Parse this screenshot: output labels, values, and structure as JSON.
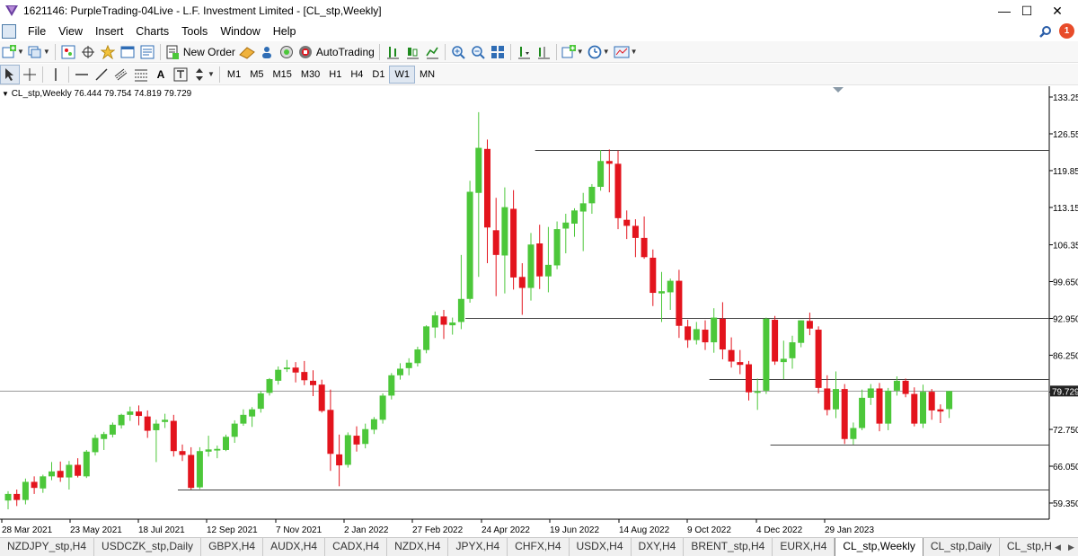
{
  "window": {
    "title": "1621146: PurpleTrading-04Live - L.F. Investment Limited - [CL_stp,Weekly]",
    "minimize": "—",
    "maximize": "☐",
    "close": "✕"
  },
  "menu": {
    "items": [
      "File",
      "View",
      "Insert",
      "Charts",
      "Tools",
      "Window",
      "Help"
    ],
    "notification_count": "1"
  },
  "toolbar1": {
    "new_order_label": "New Order",
    "autotrading_label": "AutoTrading"
  },
  "toolbar2": {
    "text_tool": "A",
    "timeframes": [
      "M1",
      "M5",
      "M15",
      "M30",
      "H1",
      "H4",
      "D1",
      "W1",
      "MN"
    ],
    "active_timeframe": "W1"
  },
  "chart": {
    "info_label": "CL_stp,Weekly  76.444 79.754 74.819 79.729",
    "current_price": "79.729",
    "colors": {
      "bull": "#4cc73a",
      "bear": "#e3141d",
      "grid_line": "#808080",
      "price_tag": "#222222"
    }
  },
  "chart_data": {
    "type": "candlestick",
    "symbol": "CL_stp",
    "timeframe": "Weekly",
    "ohlc_readout": {
      "open": 76.444,
      "high": 79.754,
      "low": 74.819,
      "close": 79.729
    },
    "y_ticks": [
      "133.25",
      "126.55",
      "119.85",
      "113.15",
      "106.35",
      "99.650",
      "92.950",
      "86.250",
      "79.550",
      "72.750",
      "66.050",
      "59.350"
    ],
    "y_tick_values": [
      133.25,
      126.55,
      119.85,
      113.15,
      106.35,
      99.65,
      92.95,
      86.25,
      79.55,
      72.75,
      66.05,
      59.35
    ],
    "x_ticks": [
      "28 Mar 2021",
      "23 May 2021",
      "18 Jul 2021",
      "12 Sep 2021",
      "7 Nov 2021",
      "2 Jan 2022",
      "27 Feb 2022",
      "24 Apr 2022",
      "19 Jun 2022",
      "14 Aug 2022",
      "9 Oct 2022",
      "4 Dec 2022",
      "29 Jan 2023"
    ],
    "ylim": [
      57.5,
      135.5
    ],
    "horizontal_lines": [
      {
        "price": 123.6,
        "from_week": 61
      },
      {
        "price": 92.95,
        "from_week": 53
      },
      {
        "price": 81.9,
        "from_week": 81
      },
      {
        "price": 79.729,
        "from_week": 0
      },
      {
        "price": 70.0,
        "from_week": 88
      },
      {
        "price": 61.8,
        "from_week": 20
      }
    ],
    "candles": [
      {
        "o": 59.8,
        "h": 61.5,
        "l": 58.2,
        "c": 61.0
      },
      {
        "o": 61.0,
        "h": 61.8,
        "l": 58.8,
        "c": 59.9
      },
      {
        "o": 59.9,
        "h": 63.8,
        "l": 59.1,
        "c": 63.2
      },
      {
        "o": 63.2,
        "h": 64.2,
        "l": 61.0,
        "c": 62.1
      },
      {
        "o": 62.0,
        "h": 64.5,
        "l": 61.2,
        "c": 64.2
      },
      {
        "o": 64.2,
        "h": 66.8,
        "l": 63.5,
        "c": 65.1
      },
      {
        "o": 65.2,
        "h": 66.9,
        "l": 63.2,
        "c": 64.0
      },
      {
        "o": 64.0,
        "h": 67.0,
        "l": 61.8,
        "c": 66.3
      },
      {
        "o": 66.3,
        "h": 67.5,
        "l": 64.0,
        "c": 64.3
      },
      {
        "o": 64.2,
        "h": 69.0,
        "l": 63.9,
        "c": 68.7
      },
      {
        "o": 68.6,
        "h": 71.8,
        "l": 68.0,
        "c": 71.2
      },
      {
        "o": 71.0,
        "h": 72.3,
        "l": 69.0,
        "c": 71.9
      },
      {
        "o": 71.8,
        "h": 74.0,
        "l": 71.3,
        "c": 73.6
      },
      {
        "o": 73.5,
        "h": 75.6,
        "l": 72.9,
        "c": 75.4
      },
      {
        "o": 75.4,
        "h": 76.9,
        "l": 74.3,
        "c": 76.0
      },
      {
        "o": 76.0,
        "h": 77.1,
        "l": 73.5,
        "c": 75.2
      },
      {
        "o": 75.1,
        "h": 76.2,
        "l": 71.2,
        "c": 72.5
      },
      {
        "o": 72.6,
        "h": 74.5,
        "l": 66.8,
        "c": 73.8
      },
      {
        "o": 74.1,
        "h": 75.6,
        "l": 73.0,
        "c": 74.5
      },
      {
        "o": 74.3,
        "h": 75.4,
        "l": 67.8,
        "c": 68.8
      },
      {
        "o": 68.8,
        "h": 70.0,
        "l": 67.0,
        "c": 68.1
      },
      {
        "o": 68.1,
        "h": 69.5,
        "l": 61.8,
        "c": 62.1
      },
      {
        "o": 62.2,
        "h": 69.5,
        "l": 61.9,
        "c": 68.8
      },
      {
        "o": 68.7,
        "h": 71.6,
        "l": 67.8,
        "c": 69.1
      },
      {
        "o": 68.9,
        "h": 69.8,
        "l": 67.5,
        "c": 69.2
      },
      {
        "o": 69.0,
        "h": 71.8,
        "l": 68.8,
        "c": 71.4
      },
      {
        "o": 71.4,
        "h": 74.4,
        "l": 70.3,
        "c": 73.8
      },
      {
        "o": 73.8,
        "h": 76.4,
        "l": 73.4,
        "c": 75.4
      },
      {
        "o": 75.1,
        "h": 76.8,
        "l": 73.2,
        "c": 76.4
      },
      {
        "o": 76.5,
        "h": 79.7,
        "l": 75.8,
        "c": 79.3
      },
      {
        "o": 79.4,
        "h": 82.1,
        "l": 78.9,
        "c": 81.9
      },
      {
        "o": 81.6,
        "h": 84.2,
        "l": 80.9,
        "c": 83.6
      },
      {
        "o": 83.7,
        "h": 85.4,
        "l": 83.2,
        "c": 84.0
      },
      {
        "o": 84.0,
        "h": 85.0,
        "l": 81.3,
        "c": 83.1
      },
      {
        "o": 83.2,
        "h": 85.2,
        "l": 80.8,
        "c": 81.7
      },
      {
        "o": 81.6,
        "h": 83.5,
        "l": 78.8,
        "c": 80.8
      },
      {
        "o": 80.9,
        "h": 81.8,
        "l": 75.8,
        "c": 76.1
      },
      {
        "o": 76.3,
        "h": 80.0,
        "l": 65.2,
        "c": 68.3
      },
      {
        "o": 68.2,
        "h": 71.8,
        "l": 62.4,
        "c": 66.2
      },
      {
        "o": 66.3,
        "h": 72.2,
        "l": 65.8,
        "c": 71.7
      },
      {
        "o": 71.6,
        "h": 73.3,
        "l": 68.7,
        "c": 70.0
      },
      {
        "o": 70.1,
        "h": 73.8,
        "l": 69.3,
        "c": 72.8
      },
      {
        "o": 72.7,
        "h": 75.0,
        "l": 71.9,
        "c": 74.6
      },
      {
        "o": 74.5,
        "h": 79.3,
        "l": 73.8,
        "c": 78.9
      },
      {
        "o": 78.9,
        "h": 83.0,
        "l": 78.2,
        "c": 82.6
      },
      {
        "o": 82.6,
        "h": 84.8,
        "l": 81.8,
        "c": 83.8
      },
      {
        "o": 83.9,
        "h": 85.7,
        "l": 82.6,
        "c": 84.9
      },
      {
        "o": 84.8,
        "h": 87.8,
        "l": 84.2,
        "c": 87.3
      },
      {
        "o": 87.2,
        "h": 91.7,
        "l": 86.6,
        "c": 91.5
      },
      {
        "o": 91.3,
        "h": 94.2,
        "l": 89.4,
        "c": 93.5
      },
      {
        "o": 93.3,
        "h": 94.5,
        "l": 89.2,
        "c": 91.8
      },
      {
        "o": 91.7,
        "h": 93.1,
        "l": 90.0,
        "c": 92.2
      },
      {
        "o": 92.3,
        "h": 104.5,
        "l": 91.0,
        "c": 96.5
      },
      {
        "o": 96.5,
        "h": 118.0,
        "l": 95.8,
        "c": 116.0
      },
      {
        "o": 115.8,
        "h": 130.5,
        "l": 100.5,
        "c": 124.0
      },
      {
        "o": 123.8,
        "h": 125.5,
        "l": 103.0,
        "c": 109.5
      },
      {
        "o": 109.0,
        "h": 114.9,
        "l": 97.0,
        "c": 104.5
      },
      {
        "o": 104.4,
        "h": 116.8,
        "l": 97.5,
        "c": 113.2
      },
      {
        "o": 112.9,
        "h": 116.3,
        "l": 98.2,
        "c": 100.4
      },
      {
        "o": 100.5,
        "h": 103.0,
        "l": 93.6,
        "c": 98.5
      },
      {
        "o": 98.5,
        "h": 108.5,
        "l": 96.2,
        "c": 106.4
      },
      {
        "o": 106.6,
        "h": 110.0,
        "l": 98.3,
        "c": 100.6
      },
      {
        "o": 100.6,
        "h": 109.6,
        "l": 97.7,
        "c": 102.7
      },
      {
        "o": 102.6,
        "h": 110.6,
        "l": 101.9,
        "c": 109.2
      },
      {
        "o": 109.3,
        "h": 112.0,
        "l": 104.8,
        "c": 110.4
      },
      {
        "o": 110.2,
        "h": 113.0,
        "l": 107.8,
        "c": 112.6
      },
      {
        "o": 112.4,
        "h": 115.8,
        "l": 105.2,
        "c": 113.9
      },
      {
        "o": 113.9,
        "h": 117.4,
        "l": 112.0,
        "c": 116.9
      },
      {
        "o": 116.9,
        "h": 123.6,
        "l": 116.2,
        "c": 121.6
      },
      {
        "o": 121.6,
        "h": 123.7,
        "l": 115.9,
        "c": 121.1
      },
      {
        "o": 121.1,
        "h": 123.5,
        "l": 109.2,
        "c": 111.2
      },
      {
        "o": 110.9,
        "h": 112.6,
        "l": 107.4,
        "c": 109.8
      },
      {
        "o": 109.8,
        "h": 111.0,
        "l": 104.1,
        "c": 107.6
      },
      {
        "o": 107.6,
        "h": 111.5,
        "l": 103.8,
        "c": 104.1
      },
      {
        "o": 104.0,
        "h": 105.5,
        "l": 95.2,
        "c": 97.6
      },
      {
        "o": 97.5,
        "h": 101.4,
        "l": 92.3,
        "c": 97.9
      },
      {
        "o": 97.7,
        "h": 100.2,
        "l": 94.5,
        "c": 99.8
      },
      {
        "o": 99.8,
        "h": 101.8,
        "l": 89.4,
        "c": 91.6
      },
      {
        "o": 91.5,
        "h": 92.7,
        "l": 87.6,
        "c": 89.0
      },
      {
        "o": 89.0,
        "h": 92.3,
        "l": 88.2,
        "c": 91.0
      },
      {
        "o": 90.9,
        "h": 92.6,
        "l": 87.2,
        "c": 88.6
      },
      {
        "o": 88.6,
        "h": 94.8,
        "l": 86.7,
        "c": 93.1
      },
      {
        "o": 92.9,
        "h": 95.9,
        "l": 85.5,
        "c": 87.3
      },
      {
        "o": 87.2,
        "h": 89.5,
        "l": 84.0,
        "c": 85.1
      },
      {
        "o": 85.0,
        "h": 87.2,
        "l": 82.8,
        "c": 84.5
      },
      {
        "o": 84.6,
        "h": 85.2,
        "l": 78.0,
        "c": 79.5
      },
      {
        "o": 79.4,
        "h": 82.0,
        "l": 76.3,
        "c": 79.7
      },
      {
        "o": 79.8,
        "h": 93.1,
        "l": 79.2,
        "c": 92.9
      },
      {
        "o": 92.7,
        "h": 93.4,
        "l": 84.5,
        "c": 85.1
      },
      {
        "o": 85.0,
        "h": 88.9,
        "l": 81.9,
        "c": 85.6
      },
      {
        "o": 85.7,
        "h": 89.8,
        "l": 83.8,
        "c": 88.6
      },
      {
        "o": 88.5,
        "h": 92.6,
        "l": 87.7,
        "c": 92.6
      },
      {
        "o": 92.5,
        "h": 94.0,
        "l": 89.9,
        "c": 91.1
      },
      {
        "o": 90.9,
        "h": 91.5,
        "l": 79.3,
        "c": 80.3
      },
      {
        "o": 80.2,
        "h": 82.6,
        "l": 75.3,
        "c": 76.3
      },
      {
        "o": 76.4,
        "h": 83.3,
        "l": 74.8,
        "c": 80.1
      },
      {
        "o": 80.1,
        "h": 81.0,
        "l": 70.1,
        "c": 71.0
      },
      {
        "o": 71.0,
        "h": 74.0,
        "l": 70.0,
        "c": 73.0
      },
      {
        "o": 73.0,
        "h": 80.0,
        "l": 72.6,
        "c": 78.5
      },
      {
        "o": 78.5,
        "h": 81.0,
        "l": 77.2,
        "c": 80.2
      },
      {
        "o": 80.2,
        "h": 81.2,
        "l": 72.4,
        "c": 73.8
      },
      {
        "o": 73.8,
        "h": 80.3,
        "l": 72.6,
        "c": 79.8
      },
      {
        "o": 79.8,
        "h": 82.4,
        "l": 78.9,
        "c": 81.6
      },
      {
        "o": 81.6,
        "h": 82.0,
        "l": 78.6,
        "c": 79.2
      },
      {
        "o": 79.2,
        "h": 80.4,
        "l": 73.3,
        "c": 73.8
      },
      {
        "o": 73.8,
        "h": 80.9,
        "l": 73.0,
        "c": 79.6
      },
      {
        "o": 79.6,
        "h": 80.1,
        "l": 74.5,
        "c": 76.2
      },
      {
        "o": 76.4,
        "h": 77.3,
        "l": 73.9,
        "c": 76.0
      },
      {
        "o": 76.444,
        "h": 79.754,
        "l": 74.819,
        "c": 79.729
      }
    ]
  },
  "tabs": {
    "items": [
      "NZDJPY_stp,H4",
      "USDCZK_stp,Daily",
      "GBPX,H4",
      "AUDX,H4",
      "CADX,H4",
      "NZDX,H4",
      "JPYX,H4",
      "CHFX,H4",
      "USDX,H4",
      "DXY,H4",
      "BRENT_stp,H4",
      "EURX,H4",
      "CL_stp,Weekly",
      "CL_stp,Daily",
      "CL_stp,H4"
    ],
    "active": "CL_stp,Weekly",
    "scroll_left": "◀",
    "scroll_right": "▶"
  }
}
